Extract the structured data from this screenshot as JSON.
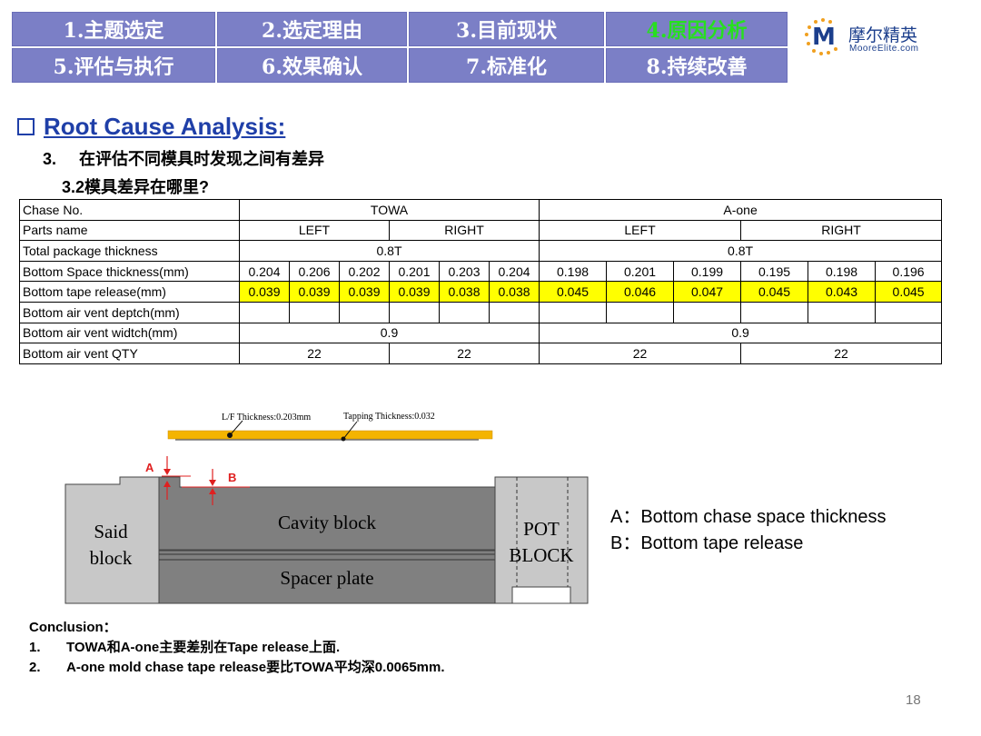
{
  "nav": {
    "cells": [
      "1.主题选定",
      "2.选定理由",
      "3.目前现状",
      "4.原因分析",
      "5.评估与执行",
      "6.效果确认",
      "7.标准化",
      "8.持续改善"
    ],
    "active_index": 3
  },
  "logo": {
    "mark": "M",
    "cn": "摩尔精英",
    "en": "MooreElite.com"
  },
  "title": "Root Cause Analysis:",
  "subtitle": {
    "num": "3.",
    "text": "在评估不同模具时发现之间有差异"
  },
  "subtitle2": "3.2模具差异在哪里?",
  "table": {
    "chase_label": "Chase No.",
    "towa": "TOWA",
    "aone": "A-one",
    "parts_label": "Parts name",
    "left": "LEFT",
    "right": "RIGHT",
    "total_label": "Total package thickness",
    "total_towa": "0.8T",
    "total_aone": "0.8T",
    "bottom_space_label": "Bottom Space thickness(mm)",
    "bottom_space": [
      "0.204",
      "0.206",
      "0.202",
      "0.201",
      "0.203",
      "0.204",
      "0.198",
      "0.201",
      "0.199",
      "0.195",
      "0.198",
      "0.196"
    ],
    "tape_label": "Bottom tape release(mm)",
    "tape": [
      "0.039",
      "0.039",
      "0.039",
      "0.039",
      "0.038",
      "0.038",
      "0.045",
      "0.046",
      "0.047",
      "0.045",
      "0.043",
      "0.045"
    ],
    "depth_label": "Bottom air vent deptch(mm)",
    "width_label": "Bottom air vent widtch(mm)",
    "width_towa": "0.9",
    "width_aone": "0.9",
    "qty_label": "Bottom air vent QTY",
    "qty": [
      "22",
      "22",
      "22",
      "22"
    ]
  },
  "diagram": {
    "lf_label": "L/F Thickness:0.203mm",
    "tape_label": "Tapping Thickness:0.032",
    "a": "A",
    "b": "B",
    "said1": "Said",
    "said2": "block",
    "cavity": "Cavity block",
    "spacer": "Spacer plate",
    "pot1": "POT",
    "pot2": "BLOCK"
  },
  "legend": {
    "a": "A：Bottom chase space thickness",
    "b": "B：Bottom tape release"
  },
  "conclusion": {
    "title": "Conclusion：",
    "items": [
      {
        "n": "1.",
        "text": "TOWA和A-one主要差别在Tape release上面."
      },
      {
        "n": "2.",
        "text": "A-one mold chase tape release要比TOWA平均深0.0065mm."
      }
    ]
  },
  "page_number": "18",
  "colors": {
    "nav_bg": "#7b7fc6",
    "nav_active_text": "#27e01e",
    "title_blue": "#1f3fa8",
    "highlight": "#ffff00",
    "tape_orange": "#f4b400"
  }
}
